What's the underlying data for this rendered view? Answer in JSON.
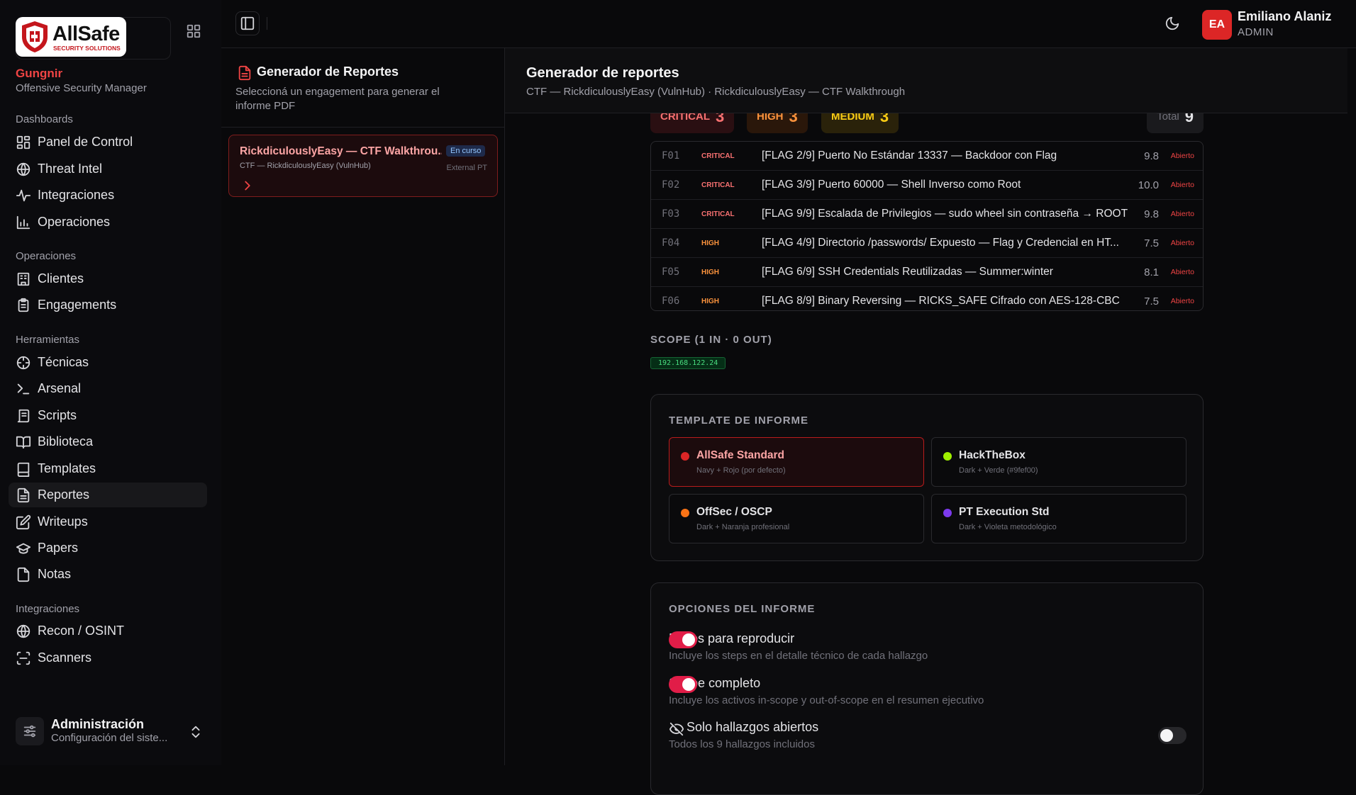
{
  "brand": {
    "logo_text": "AllSafe",
    "logo_tagline": "SECURITY SOLUTIONS",
    "org_name": "Gungnir",
    "org_subtitle": "Offensive Security Manager"
  },
  "sidebar": {
    "sections": [
      {
        "title": "Dashboards",
        "items": [
          {
            "label": "Panel de Control",
            "icon": "layout-dashboard-icon"
          },
          {
            "label": "Threat Intel",
            "icon": "globe-icon"
          },
          {
            "label": "Integraciones",
            "icon": "activity-icon"
          },
          {
            "label": "Operaciones",
            "icon": "bar-chart-icon"
          }
        ]
      },
      {
        "title": "Operaciones",
        "items": [
          {
            "label": "Clientes",
            "icon": "building-icon"
          },
          {
            "label": "Engagements",
            "icon": "clipboard-icon"
          }
        ]
      },
      {
        "title": "Herramientas",
        "items": [
          {
            "label": "Técnicas",
            "icon": "crosshair-icon"
          },
          {
            "label": "Arsenal",
            "icon": "terminal-icon"
          },
          {
            "label": "Scripts",
            "icon": "scroll-icon"
          },
          {
            "label": "Biblioteca",
            "icon": "book-open-icon"
          },
          {
            "label": "Templates",
            "icon": "book-icon"
          },
          {
            "label": "Reportes",
            "icon": "file-text-icon",
            "active": true
          },
          {
            "label": "Writeups",
            "icon": "edit-icon"
          },
          {
            "label": "Papers",
            "icon": "graduation-cap-icon"
          },
          {
            "label": "Notas",
            "icon": "file-icon"
          }
        ]
      },
      {
        "title": "Integraciones",
        "items": [
          {
            "label": "Recon / OSINT",
            "icon": "globe-icon"
          },
          {
            "label": "Scanners",
            "icon": "scan-icon"
          }
        ]
      }
    ],
    "admin": {
      "title": "Administración",
      "subtitle": "Configuración del siste..."
    }
  },
  "topbar": {
    "user_initials": "EA",
    "user_name": "Emiliano Alaniz",
    "user_role": "ADMIN"
  },
  "mid_panel": {
    "title": "Generador de Reportes",
    "description": "Seleccioná un engagement para generar el informe PDF",
    "engagement": {
      "title": "RickdiculouslyEasy — CTF Walkthrou...",
      "subtitle": "CTF — RickdiculouslyEasy (VulnHub)",
      "badge": "En curso",
      "type": "External PT"
    }
  },
  "main": {
    "title": "Generador de reportes",
    "subtitle": "CTF — RickdiculouslyEasy (VulnHub) · RickdiculouslyEasy — CTF Walkthrough",
    "severity": {
      "critical_label": "CRITICAL",
      "critical_count": "3",
      "high_label": "HIGH",
      "high_count": "3",
      "medium_label": "MEDIUM",
      "medium_count": "3",
      "total_label": "Total",
      "total_count": "9"
    },
    "findings": [
      {
        "id": "F01",
        "severity": "CRITICAL",
        "title": "[FLAG 2/9] Puerto No Estándar 13337 — Backdoor con Flag",
        "score": "9.8",
        "status": "Abierto"
      },
      {
        "id": "F02",
        "severity": "CRITICAL",
        "title": "[FLAG 3/9] Puerto 60000 — Shell Inverso como Root",
        "score": "10.0",
        "status": "Abierto"
      },
      {
        "id": "F03",
        "severity": "CRITICAL",
        "title": "[FLAG 9/9] Escalada de Privilegios — sudo wheel sin contraseña → ROOT",
        "score": "9.8",
        "status": "Abierto"
      },
      {
        "id": "F04",
        "severity": "HIGH",
        "title": "[FLAG 4/9] Directorio /passwords/ Expuesto — Flag y Credencial en HT...",
        "score": "7.5",
        "status": "Abierto"
      },
      {
        "id": "F05",
        "severity": "HIGH",
        "title": "[FLAG 6/9] SSH Credentials Reutilizadas — Summer:winter",
        "score": "8.1",
        "status": "Abierto"
      },
      {
        "id": "F06",
        "severity": "HIGH",
        "title": "[FLAG 8/9] Binary Reversing — RICKS_SAFE Cifrado con AES-128-CBC",
        "score": "7.5",
        "status": "Abierto"
      }
    ],
    "scope": {
      "title": "SCOPE (1 IN · 0 OUT)",
      "ip": "192.168.122.24"
    },
    "templates": {
      "title": "TEMPLATE DE INFORME",
      "items": [
        {
          "name": "AllSafe Standard",
          "desc": "Navy + Rojo (por defecto)",
          "color": "#dc2626",
          "selected": true
        },
        {
          "name": "HackTheBox",
          "desc": "Dark + Verde (#9fef00)",
          "color": "#9fef00",
          "selected": false
        },
        {
          "name": "OffSec / OSCP",
          "desc": "Dark + Naranja profesional",
          "color": "#f97316",
          "selected": false
        },
        {
          "name": "PT Execution Std",
          "desc": "Dark + Violeta metodológico",
          "color": "#7c3aed",
          "selected": false
        }
      ]
    },
    "options": {
      "title": "OPCIONES DEL INFORME",
      "items": [
        {
          "name": "Pasos para reproducir",
          "desc": "Incluye los steps en el detalle técnico de cada hallazgo",
          "enabled": true
        },
        {
          "name": "Scope completo",
          "desc": "Incluye los activos in-scope y out-of-scope en el resumen ejecutivo",
          "enabled": true
        },
        {
          "name": "Solo hallazgos abiertos",
          "desc": "Todos los 9 hallazgos incluidos",
          "enabled": false
        }
      ]
    }
  },
  "colors": {
    "accent": "#ef4444",
    "critical": "#f87171",
    "high": "#fb923c",
    "medium": "#facc15",
    "toggle_on": "#e11d48"
  }
}
